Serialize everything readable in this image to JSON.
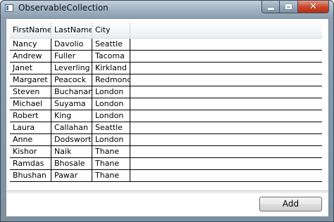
{
  "window": {
    "title": "ObservableCollection",
    "controls": {
      "minimize_icon": "minimize-icon",
      "maximize_icon": "maximize-icon",
      "close_icon": "close-icon",
      "close_glyph": "✕"
    }
  },
  "grid": {
    "columns": [
      "FirstName",
      "LastName",
      "City"
    ],
    "rows": [
      [
        "Nancy",
        "Davolio",
        "Seattle"
      ],
      [
        "Andrew",
        "Fuller",
        "Tacoma"
      ],
      [
        "Janet",
        "Leverling",
        "Kirkland"
      ],
      [
        "Margaret",
        "Peacock",
        "Redmond"
      ],
      [
        "Steven",
        "Buchanan",
        "London"
      ],
      [
        "Michael",
        "Suyama",
        "London"
      ],
      [
        "Robert",
        "King",
        "London"
      ],
      [
        "Laura",
        "Callahan",
        "Seattle"
      ],
      [
        "Anne",
        "Dodsworth",
        "London"
      ],
      [
        "Kishor",
        "Naik",
        "Thane"
      ],
      [
        "Ramdas",
        "Bhosale",
        "Thane"
      ],
      [
        "Bhushan",
        "Pawar",
        "Thane"
      ]
    ]
  },
  "footer": {
    "add_label": "Add"
  },
  "colors": {
    "close_button": "#c8432a",
    "title_bar": "#a9b9c7",
    "grid_line": "#000000"
  }
}
